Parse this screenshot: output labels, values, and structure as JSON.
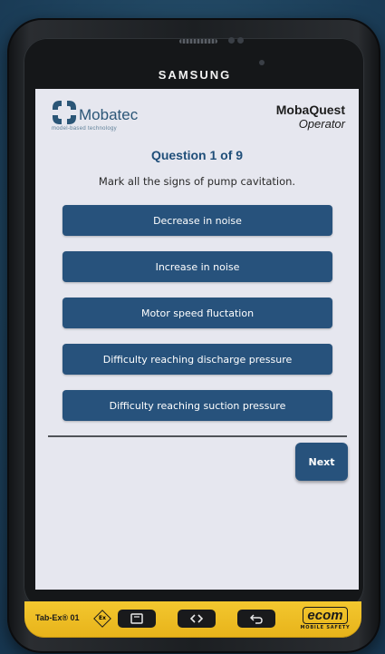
{
  "device": {
    "brand": "SAMSUNG",
    "model": "Tab-Ex® 01",
    "ex_symbol": "Ex",
    "ecom_logo": "ecom",
    "ecom_tagline": "MOBILE SAFETY"
  },
  "header": {
    "logo_text": "Mobatec",
    "logo_subtitle": "model-based technology",
    "app_name": "MobaQuest",
    "app_role": "Operator"
  },
  "quiz": {
    "question_title": "Question 1 of 9",
    "question_text": "Mark all the signs of pump cavitation.",
    "answers": [
      {
        "label": "Decrease in noise"
      },
      {
        "label": "Increase in noise"
      },
      {
        "label": "Motor speed fluctation"
      },
      {
        "label": "Difficulty reaching discharge pressure"
      },
      {
        "label": "Difficulty reaching suction pressure"
      }
    ],
    "next_label": "Next"
  },
  "colors": {
    "accent": "#27527c",
    "title_blue": "#1f4e79",
    "screen_bg": "#e6e7ef",
    "device_yellow": "#f3c72f"
  },
  "icons": {
    "logo": "mobatec-logo-icon",
    "recent_apps": "recent-apps-icon",
    "home": "home-icon",
    "back": "back-icon"
  }
}
